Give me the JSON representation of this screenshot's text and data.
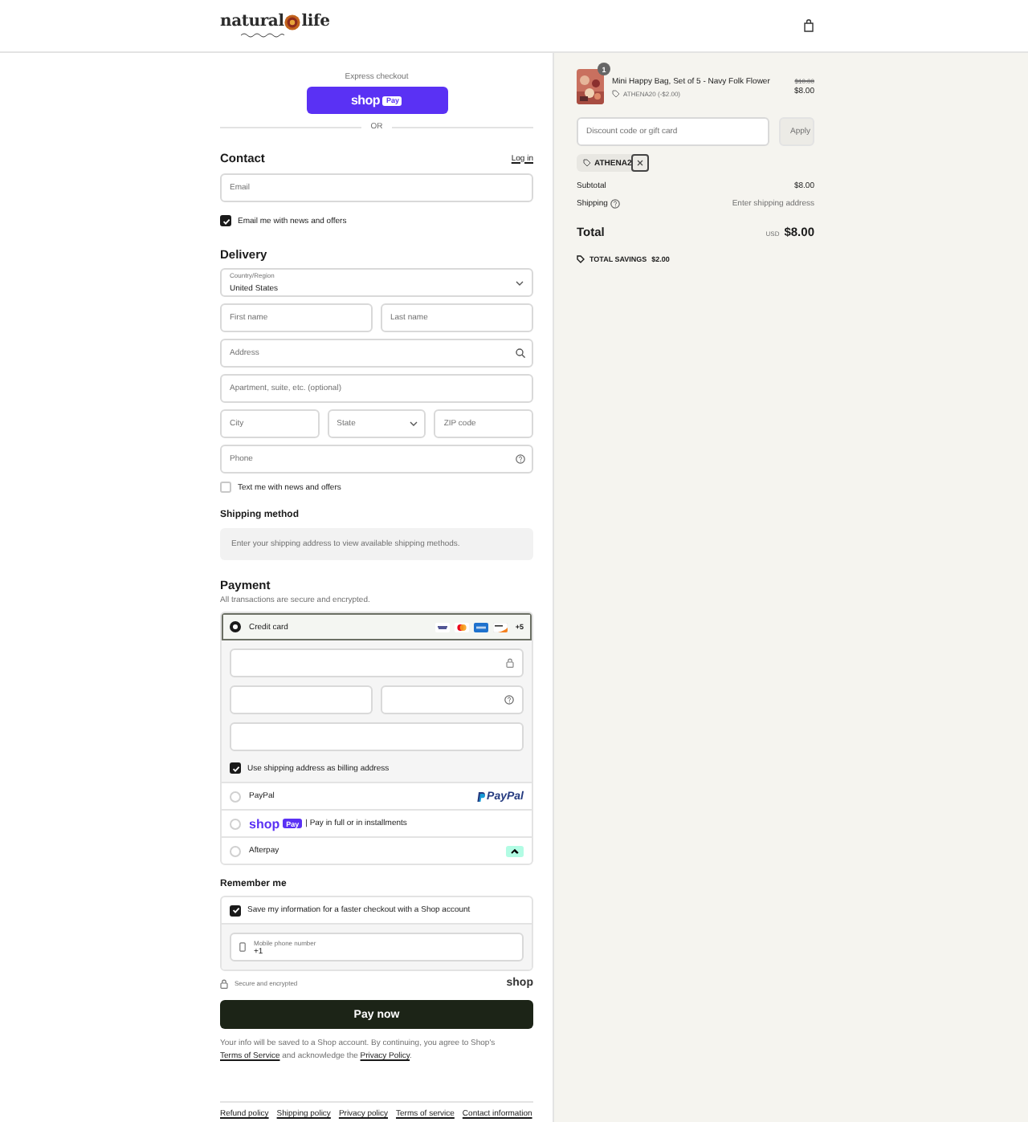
{
  "header": {
    "logo_left": "natural",
    "logo_right": "life"
  },
  "express": {
    "label": "Express checkout",
    "brand": "shop",
    "badge": "Pay",
    "divider": "OR"
  },
  "contact": {
    "heading": "Contact",
    "login": "Log in",
    "email": {
      "placeholder": "Email"
    },
    "newsletter": {
      "label": "Email me with news and offers",
      "checked": true
    }
  },
  "delivery": {
    "heading": "Delivery",
    "country": {
      "label": "Country/Region",
      "value": "United States"
    },
    "rows": [
      [
        {
          "kind": "text",
          "placeholder": "First name"
        },
        {
          "kind": "text",
          "placeholder": "Last name"
        }
      ],
      [
        {
          "kind": "search",
          "placeholder": "Address"
        }
      ],
      [
        {
          "kind": "text",
          "placeholder": "Apartment, suite, etc. (optional)"
        }
      ],
      [
        {
          "kind": "text",
          "placeholder": "City"
        },
        {
          "kind": "select",
          "placeholder": "State"
        },
        {
          "kind": "text",
          "placeholder": "ZIP code"
        }
      ],
      [
        {
          "kind": "help",
          "placeholder": "Phone"
        }
      ]
    ],
    "sms": {
      "label": "Text me with news and offers",
      "checked": false
    }
  },
  "shipping_method": {
    "heading": "Shipping method",
    "message": "Enter your shipping address to view available shipping methods."
  },
  "payment": {
    "heading": "Payment",
    "subtitle": "All transactions are secure and encrypted.",
    "methods": [
      {
        "kind": "card",
        "label": "Credit card",
        "selected": true,
        "more": "+5"
      },
      {
        "kind": "paypal",
        "label": "PayPal",
        "logo": "PayPal",
        "selected": false
      },
      {
        "kind": "shoppay",
        "brand": "shop",
        "badge": "Pay",
        "label": "| Pay in full or in installments",
        "selected": false
      },
      {
        "kind": "afterpay",
        "label": "Afterpay",
        "selected": false
      }
    ],
    "card_fields": [
      [
        {
          "kind": "lock"
        }
      ],
      [
        {
          "kind": "plain"
        },
        {
          "kind": "help"
        }
      ],
      [
        {
          "kind": "plain"
        }
      ]
    ],
    "billing": {
      "label": "Use shipping address as billing address",
      "checked": true
    }
  },
  "remember": {
    "heading": "Remember me",
    "save": {
      "label": "Save my information for a faster checkout with a Shop account",
      "checked": true
    },
    "phone": {
      "label": "Mobile phone number",
      "value": "+1"
    },
    "secure": "Secure and encrypted",
    "brand": "shop"
  },
  "pay_button": "Pay now",
  "disclaimer": {
    "text_1": "Your info will be saved to a Shop account. By continuing, you agree to Shop's ",
    "link_1": "Terms of Service",
    "text_2": " and acknowledge the ",
    "link_2": "Privacy Policy",
    "text_3": "."
  },
  "footer_links": [
    "Refund policy",
    "Shipping policy",
    "Privacy policy",
    "Terms of service",
    "Contact information"
  ],
  "summary": {
    "items": [
      {
        "name": "Mini Happy Bag, Set of 5 - Navy Folk Flower",
        "quantity": "1",
        "discount": "ATHENA20 (-$2.00)",
        "original_price": "$10.00",
        "price": "$8.00"
      }
    ],
    "discount_field": {
      "placeholder": "Discount code or gift card"
    },
    "apply": "Apply",
    "codes": [
      {
        "code": "ATHENA2"
      }
    ],
    "subtotal": {
      "label": "Subtotal",
      "value": "$8.00"
    },
    "shipping": {
      "label": "Shipping",
      "value": "Enter shipping address"
    },
    "total": {
      "label": "Total",
      "currency": "USD",
      "value": "$8.00"
    },
    "savings": {
      "label": "TOTAL SAVINGS",
      "value": "$2.00"
    }
  }
}
